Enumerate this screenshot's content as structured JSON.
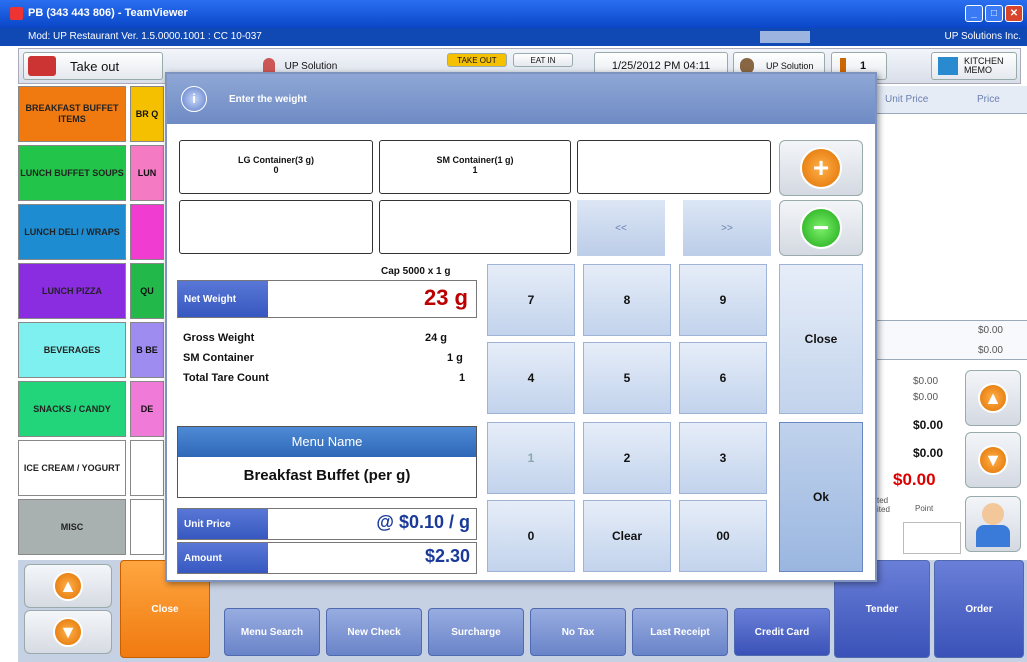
{
  "window": {
    "title": "PB (343 443 806) - TeamViewer",
    "subtitle": "Mod: UP Restaurant Ver. 1.5.0000.1001 : CC 10-037",
    "company": "UP Solutions Inc."
  },
  "topbar": {
    "order_type": "Take out",
    "user": "UP Solution",
    "take_out_tab": "TAKE OUT",
    "eat_in_tab": "EAT IN",
    "datetime": "1/25/2012 PM 04:11",
    "user2": "UP Solution",
    "guests": "1",
    "kitchen_memo": "KITCHEN MEMO"
  },
  "categories": [
    {
      "label": "BREAKFAST BUFFET ITEMS",
      "label2": "BR Q",
      "color": "#f07a10",
      "color2": "#f5c000"
    },
    {
      "label": "LUNCH BUFFET SOUPS",
      "label2": "LUN",
      "color": "#22c44a",
      "color2": "#f47ac4"
    },
    {
      "label": "LUNCH DELI / WRAPS",
      "label2": "",
      "color": "#1e8cd0",
      "color2": "#f03cd0"
    },
    {
      "label": "LUNCH PIZZA",
      "label2": "QU",
      "color": "#8a2ce0",
      "color2": "#22b84a"
    },
    {
      "label": "BEVERAGES",
      "label2": "B BE",
      "color": "#7ef0f0",
      "color2": "#9e8cf0"
    },
    {
      "label": "SNACKS / CANDY",
      "label2": "DE",
      "color": "#22d47a",
      "color2": "#f07ad8"
    },
    {
      "label": "ICE CREAM / YOGURT",
      "label2": "",
      "color": "#ffffff",
      "color2": "#ffffff"
    },
    {
      "label": "MISC",
      "label2": "",
      "color": "#a8b0b0",
      "color2": "#ffffff"
    }
  ],
  "order_table": {
    "headers": [
      "Unit Price",
      "Price"
    ],
    "row1": "$0.00",
    "row2": "$0.00",
    "totals": [
      "$0.00",
      "$0.00",
      "$0.00",
      "$0.00"
    ],
    "grand_total": "$0.00",
    "col_a": "ted ited",
    "col_b": "Point"
  },
  "bottom": {
    "close": "Close",
    "menu_search": "Menu Search",
    "new_check": "New Check",
    "surcharge": "Surcharge",
    "no_tax": "No Tax",
    "last_receipt": "Last Receipt",
    "credit_card": "Credit Card",
    "tender": "Tender",
    "order": "Order"
  },
  "dialog": {
    "title": "Enter the weight",
    "containers": [
      {
        "name": "LG Container(3 g)",
        "count": "0"
      },
      {
        "name": "SM Container(1 g)",
        "count": "1"
      }
    ],
    "prev": "<<",
    "next": ">>",
    "cap": "Cap 5000 x 1 g",
    "net_weight_label": "Net Weight",
    "net_weight_value": "23 g",
    "gross_label": "Gross Weight",
    "gross_value": "24 g",
    "sm_label": "SM Container",
    "sm_value": "1 g",
    "tare_label": "Total Tare Count",
    "tare_value": "1",
    "menu_name_label": "Menu Name",
    "menu_name_value": "Breakfast Buffet (per g)",
    "unit_price_label": "Unit Price",
    "unit_price_value": "@ $0.10 / g",
    "amount_label": "Amount",
    "amount_value": "$2.30",
    "keys": [
      "7",
      "8",
      "9",
      "4",
      "5",
      "6",
      "1",
      "2",
      "3",
      "0",
      "Clear",
      "00"
    ],
    "close": "Close",
    "ok": "Ok"
  }
}
